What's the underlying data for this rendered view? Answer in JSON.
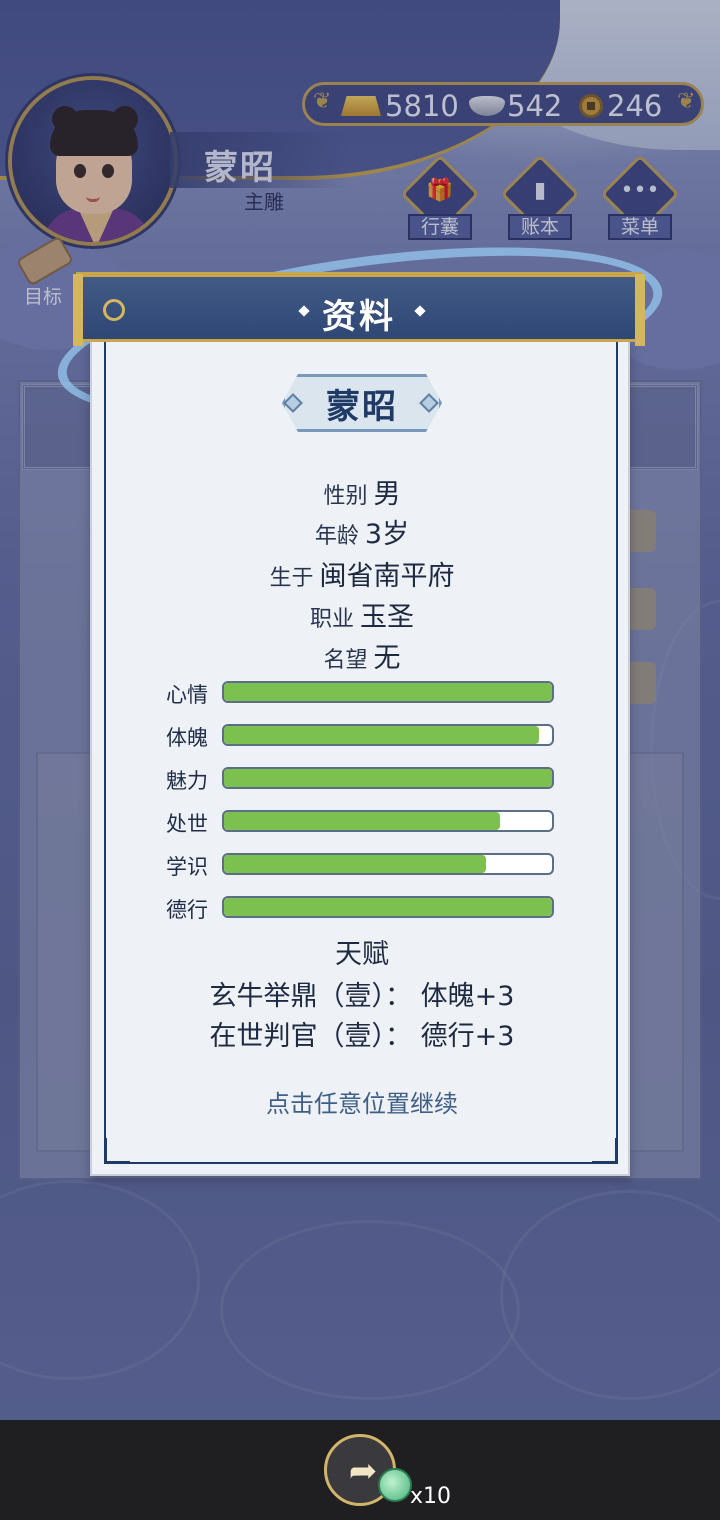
{
  "header": {
    "player_name": "蒙昭",
    "player_role": "主雕",
    "currency": {
      "gold": "5810",
      "silver": "542",
      "coins": "246"
    },
    "menu": [
      {
        "label": "行囊",
        "icon": "bag-icon"
      },
      {
        "label": "账本",
        "icon": "ledger-icon"
      },
      {
        "label": "菜单",
        "icon": "more-icon"
      }
    ],
    "goal_label": "目标"
  },
  "dialog": {
    "title": "资料",
    "name": "蒙昭",
    "info": [
      {
        "key": "性别",
        "value": "男"
      },
      {
        "key": "年龄",
        "value": "3岁"
      },
      {
        "key": "生于",
        "value": "闽省南平府"
      },
      {
        "key": "职业",
        "value": "玉圣"
      },
      {
        "key": "名望",
        "value": "无"
      }
    ],
    "stats": [
      {
        "label": "心情",
        "value": 1.0
      },
      {
        "label": "体魄",
        "value": 0.96
      },
      {
        "label": "魅力",
        "value": 1.0
      },
      {
        "label": "处世",
        "value": 0.84
      },
      {
        "label": "学识",
        "value": 0.8
      },
      {
        "label": "德行",
        "value": 1.0
      }
    ],
    "talent_title": "天赋",
    "talents": [
      "玄牛举鼎（壹）：  体魄+3",
      "在世判官（壹）：  德行+3"
    ],
    "continue_text": "点击任意位置继续",
    "bar_color": "#7cc04f"
  },
  "bottom": {
    "ad_count": "x10"
  }
}
